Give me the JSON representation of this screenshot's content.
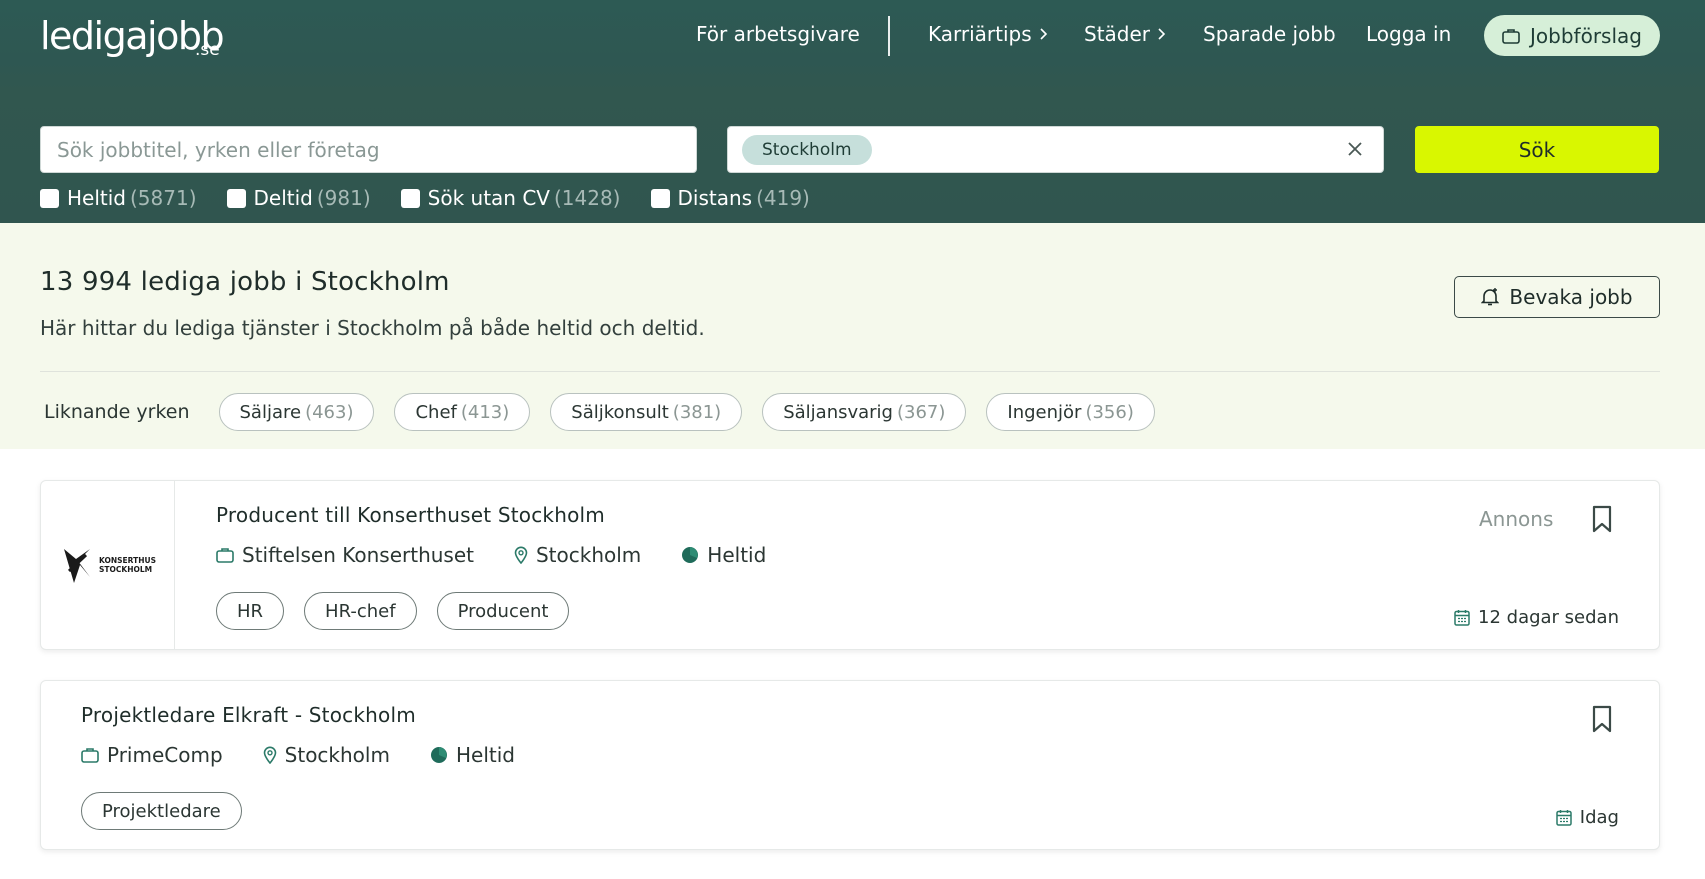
{
  "header": {
    "logo_main": "ledigajobb",
    "logo_tld": ".se",
    "nav": {
      "employers": "För arbetsgivare",
      "career_tips": "Karriärtips",
      "cities": "Städer",
      "saved_jobs": "Sparade jobb",
      "login": "Logga in",
      "job_suggestions": "Jobbförslag"
    }
  },
  "search": {
    "query_placeholder": "Sök jobbtitel, yrken eller företag",
    "location_chip": "Stockholm",
    "submit_label": "Sök",
    "filters": [
      {
        "label": "Heltid",
        "count": "(5871)"
      },
      {
        "label": "Deltid",
        "count": "(981)"
      },
      {
        "label": "Sök utan CV",
        "count": "(1428)"
      },
      {
        "label": "Distans",
        "count": "(419)"
      }
    ]
  },
  "intro": {
    "title": "13 994 lediga jobb i Stockholm",
    "description": "Här hittar du lediga tjänster i Stockholm på både heltid och deltid.",
    "watch_label": "Bevaka jobb",
    "similar_label": "Liknande yrken",
    "similar": [
      {
        "label": "Säljare",
        "count": "(463)"
      },
      {
        "label": "Chef",
        "count": "(413)"
      },
      {
        "label": "Säljkonsult",
        "count": "(381)"
      },
      {
        "label": "Säljansvarig",
        "count": "(367)"
      },
      {
        "label": "Ingenjör",
        "count": "(356)"
      }
    ]
  },
  "jobs": [
    {
      "title": "Producent till Konserthuset Stockholm",
      "company": "Stiftelsen Konserthuset",
      "location": "Stockholm",
      "type": "Heltid",
      "tags": [
        "HR",
        "HR-chef",
        "Producent"
      ],
      "badge": "Annons",
      "date": "12 dagar sedan",
      "logo_text_1": "KONSERTHUSET",
      "logo_text_2": "STOCKHOLM"
    },
    {
      "title": "Projektledare Elkraft - Stockholm",
      "company": "PrimeComp",
      "location": "Stockholm",
      "type": "Heltid",
      "tags": [
        "Projektledare"
      ],
      "date": "Idag"
    }
  ],
  "colors": {
    "header_bg": "#2e5752",
    "accent_yellow": "#d9f700",
    "icon_green": "#2b7a68",
    "intro_bg": "#f5f9ec"
  }
}
